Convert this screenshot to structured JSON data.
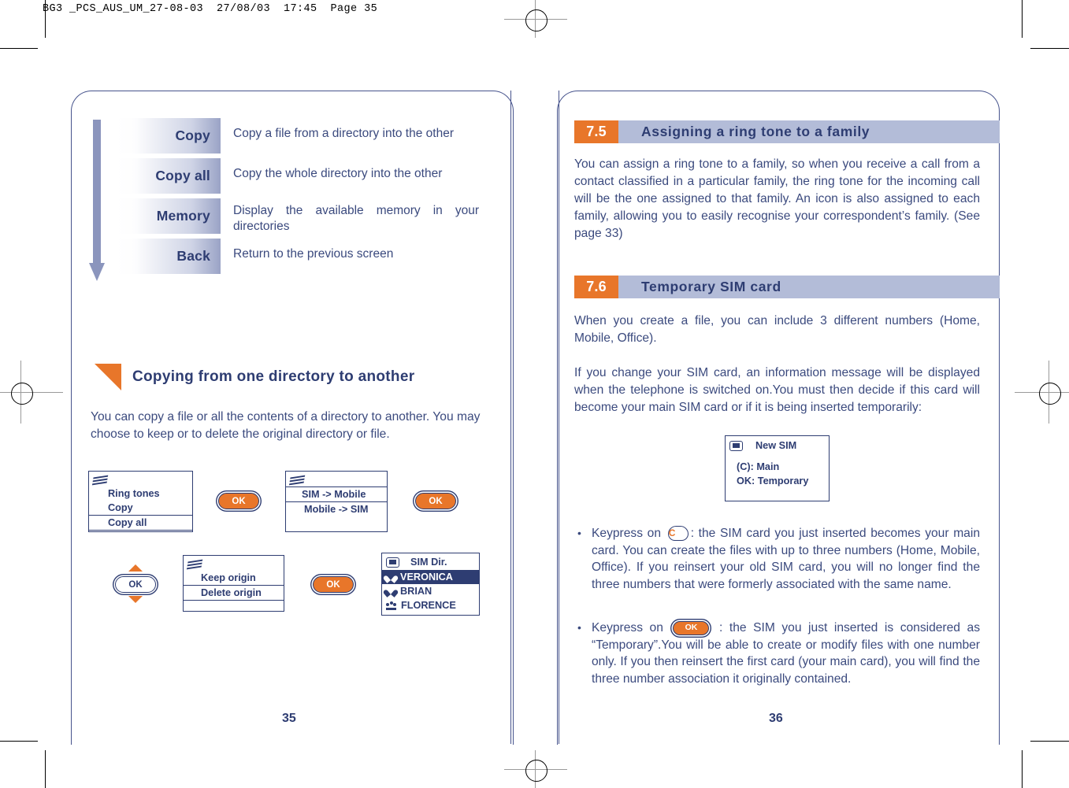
{
  "print_header": "BG3 _PCS_AUS_UM_27-08-03  27/08/03  17:45  Page 35",
  "colors": {
    "accent_orange": "#e8762a",
    "ink_blue": "#2e3d72",
    "body_blue": "#3b4a7e",
    "bar_blue": "#b3bcd8"
  },
  "left_page": {
    "page_number": "35",
    "menu_rows": [
      {
        "label": "Copy",
        "description": "Copy a file from a directory into the other"
      },
      {
        "label": "Copy all",
        "description": "Copy the whole directory into the other"
      },
      {
        "label": "Memory",
        "description": "Display the available memory in your directories"
      },
      {
        "label": "Back",
        "description": "Return to the previous screen"
      }
    ],
    "heading": "Copying from one directory to another",
    "body_lines": "You can copy a file or all the contents of a directory to another. You may choose to keep or to delete the original directory or file.",
    "screens": {
      "screen1": {
        "icon": "directory-icon",
        "items": [
          "Ring tones",
          "Copy",
          "Copy all"
        ],
        "selected": "Copy all"
      },
      "screen2": {
        "icon": "directory-icon",
        "items": [
          "SIM -> Mobile",
          "Mobile -> SIM"
        ],
        "selected": "SIM -> Mobile"
      },
      "screen3": {
        "icon": "directory-icon",
        "items": [
          "Keep origin",
          "Delete origin"
        ],
        "selected": "Delete origin"
      },
      "screen4": {
        "icon": "sim-icon",
        "title": "SIM Dir.",
        "items": [
          "VERONICA",
          "BRIAN",
          "FLORENCE"
        ],
        "selected": "VERONICA"
      }
    },
    "ok_label": "OK"
  },
  "right_page": {
    "page_number": "36",
    "sections": [
      {
        "number": "7.5",
        "title": "Assigning a ring tone to a family",
        "paragraphs": [
          "You can assign a ring tone to a family, so when you receive a call from a contact classified in a particular family, the ring tone for the incoming call will be the one assigned to that family. An icon is also assigned to each family, allowing you to easily recognise your correspondent’s family. (See page 33)"
        ]
      },
      {
        "number": "7.6",
        "title": "Temporary SIM card",
        "paragraphs": [
          "When you create a file, you can include 3 different numbers (Home, Mobile, Office).",
          "If you change your SIM card, an information message will be displayed when the telephone is switched on.You must then decide if this card will become your main SIM card or if it is being inserted temporarily:"
        ]
      }
    ],
    "new_sim_dialog": {
      "icon": "sim-icon",
      "title": "New SIM",
      "line1": "(C): Main",
      "line2": "OK: Temporary"
    },
    "bullets": [
      {
        "prefix": "Keypress on",
        "key": "C",
        "key_icon": "c-key-icon",
        "text": ": the SIM card you just inserted becomes your main card. You can create the files with up to three numbers (Home, Mobile, Office). If you reinsert your old SIM card, you will no longer find the three numbers that were formerly associated with the same name."
      },
      {
        "prefix": "Keypress on",
        "key": "OK",
        "key_icon": "ok-key-icon",
        "text": ": the SIM you just inserted is considered as “Temporary”.You will be able to create or modify files with one number  only. If you then reinsert the first card (your main card), you will find the three number association it originally contained."
      }
    ]
  }
}
